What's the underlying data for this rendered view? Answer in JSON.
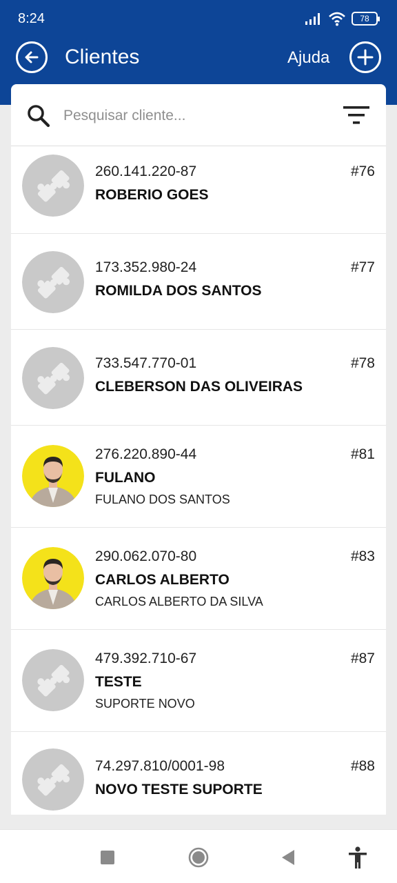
{
  "status_bar": {
    "time": "8:24",
    "battery": "78",
    "icons": [
      "signal-icon",
      "wifi-icon",
      "battery-icon"
    ]
  },
  "app_bar": {
    "title": "Clientes",
    "help_label": "Ajuda",
    "back_icon": "arrow-left-circle-icon",
    "add_icon": "plus-circle-icon"
  },
  "search": {
    "placeholder": "Pesquisar cliente...",
    "value": "",
    "icon": "search-icon",
    "filter_icon": "filter-icon"
  },
  "colors": {
    "header": "#0d4597",
    "avatar_placeholder": "#c9c9c9",
    "avatar_photo_bg": "#f4e21a"
  },
  "clients": [
    {
      "doc": "260.141.220-87",
      "name": "ROBERIO GOES",
      "subtitle": "",
      "code": "#76",
      "avatar": "puzzle-icon"
    },
    {
      "doc": "173.352.980-24",
      "name": "ROMILDA DOS SANTOS",
      "subtitle": "",
      "code": "#77",
      "avatar": "puzzle-icon"
    },
    {
      "doc": "733.547.770-01",
      "name": "CLEBERSON DAS OLIVEIRAS",
      "subtitle": "",
      "code": "#78",
      "avatar": "puzzle-icon"
    },
    {
      "doc": "276.220.890-44",
      "name": "FULANO",
      "subtitle": "FULANO DOS SANTOS",
      "code": "#81",
      "avatar": "person-photo"
    },
    {
      "doc": "290.062.070-80",
      "name": "CARLOS ALBERTO",
      "subtitle": "CARLOS ALBERTO DA SILVA",
      "code": "#83",
      "avatar": "person-photo"
    },
    {
      "doc": "479.392.710-67",
      "name": "TESTE",
      "subtitle": "SUPORTE NOVO",
      "code": "#87",
      "avatar": "puzzle-icon"
    },
    {
      "doc": "74.297.810/0001-98",
      "name": "NOVO TESTE SUPORTE",
      "subtitle": "",
      "code": "#88",
      "avatar": "puzzle-icon"
    }
  ],
  "nav_bar": {
    "buttons": [
      "recents-square-icon",
      "home-circle-icon",
      "back-triangle-icon",
      "accessibility-icon"
    ]
  }
}
